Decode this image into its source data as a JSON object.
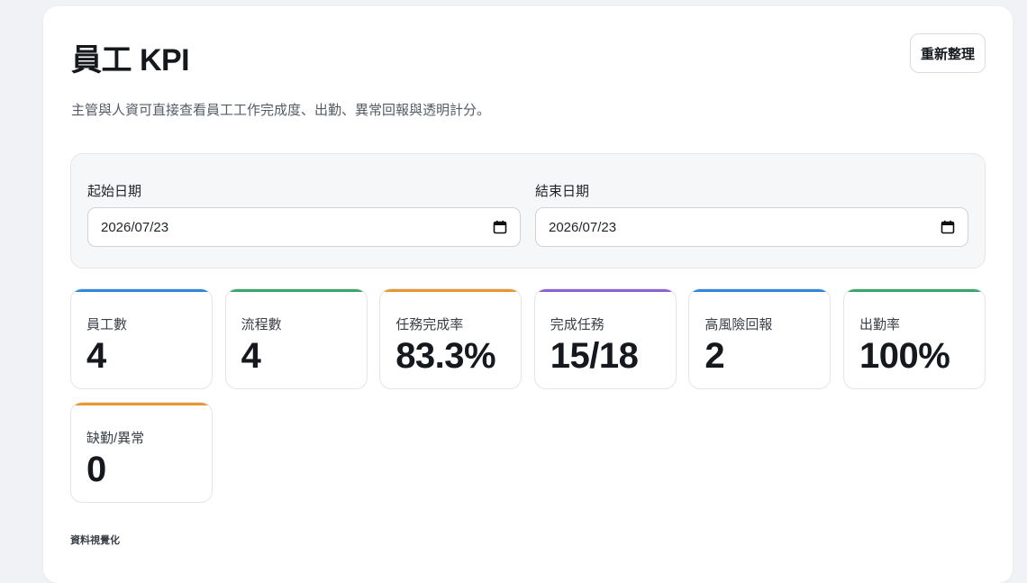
{
  "header": {
    "title": "員工 KPI",
    "refresh_label": "重新整理",
    "subtitle": "主管與人資可直接查看員工工作完成度、出勤、異常回報與透明計分。"
  },
  "filters": {
    "start": {
      "label": "起始日期",
      "value": "2026/07/23"
    },
    "end": {
      "label": "結束日期",
      "value": "2026/07/23"
    }
  },
  "cards": [
    {
      "label": "員工數",
      "value": "4",
      "accent": "#2f88d8"
    },
    {
      "label": "流程數",
      "value": "4",
      "accent": "#3aa66a"
    },
    {
      "label": "任務完成率",
      "value": "83.3%",
      "accent": "#e8962e"
    },
    {
      "label": "完成任務",
      "value": "15/18",
      "accent": "#8a63d2"
    },
    {
      "label": "高風險回報",
      "value": "2",
      "accent": "#2f88d8"
    },
    {
      "label": "出勤率",
      "value": "100%",
      "accent": "#3aa66a"
    },
    {
      "label": "缺勤/異常",
      "value": "0",
      "accent": "#e8962e"
    }
  ],
  "section": {
    "visualization_label": "資料視覺化"
  },
  "icons": {
    "date_picker": "calendar-icon"
  }
}
